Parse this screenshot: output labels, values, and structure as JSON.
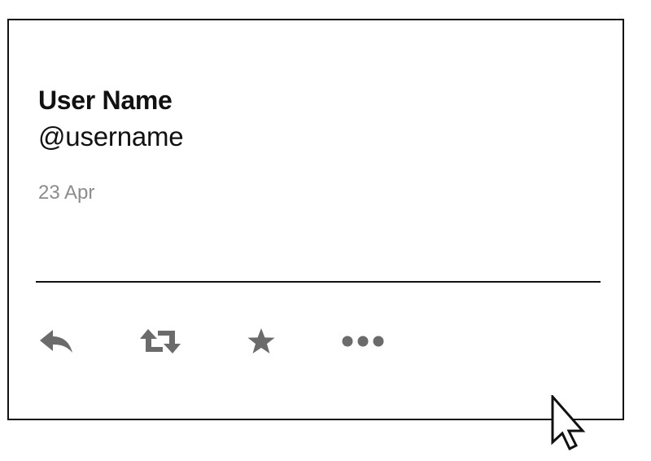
{
  "tweet": {
    "user_name": "User Name",
    "handle": "@username",
    "date": "23 Apr"
  },
  "actions": [
    {
      "name": "reply",
      "icon": "reply-icon"
    },
    {
      "name": "retweet",
      "icon": "retweet-icon"
    },
    {
      "name": "favorite",
      "icon": "star-icon"
    },
    {
      "name": "more",
      "icon": "more-dots-icon"
    }
  ],
  "colors": {
    "border": "#111111",
    "text": "#111111",
    "muted_text": "#8c8c8c",
    "icon": "#6b6b6b"
  }
}
